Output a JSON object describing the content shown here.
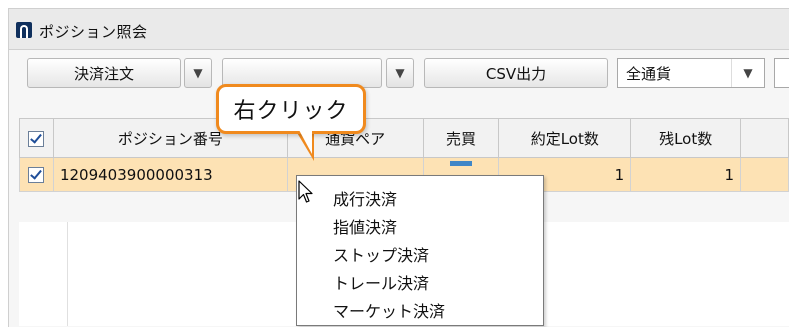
{
  "window": {
    "title": "ポジション照会"
  },
  "toolbar": {
    "settle_order_label": "決済注文",
    "csv_label": "CSV出力",
    "currency_select_value": "全通貨",
    "second_select_value": ""
  },
  "table": {
    "headers": [
      "ポジション番号",
      "通貨ペア",
      "売買",
      "約定Lot数",
      "残Lot数"
    ],
    "rows": [
      {
        "position_no": "1209403900000313",
        "pair": "",
        "side": "",
        "lots": "1",
        "remaining": "1"
      }
    ]
  },
  "context_menu": {
    "items": [
      "成行決済",
      "指値決済",
      "ストップ決済",
      "トレール決済",
      "マーケット決済"
    ]
  },
  "callout": {
    "label": "右クリック"
  },
  "colors": {
    "accent": "#f08a1e",
    "selected_row": "#fde2b4",
    "app_icon": "#0f2f5c"
  }
}
